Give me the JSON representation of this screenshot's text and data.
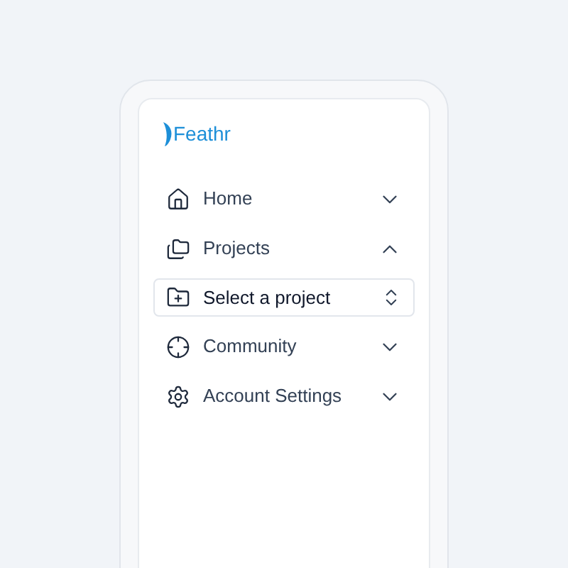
{
  "logo": {
    "text": "Feathr"
  },
  "nav": [
    {
      "kind": "nav",
      "label": "Home",
      "expanded": false
    },
    {
      "kind": "nav",
      "label": "Projects",
      "expanded": true
    },
    {
      "kind": "select",
      "label": "Select a project"
    },
    {
      "kind": "nav",
      "label": "Community",
      "expanded": false
    },
    {
      "kind": "nav",
      "label": "Account Settings",
      "expanded": false
    }
  ]
}
